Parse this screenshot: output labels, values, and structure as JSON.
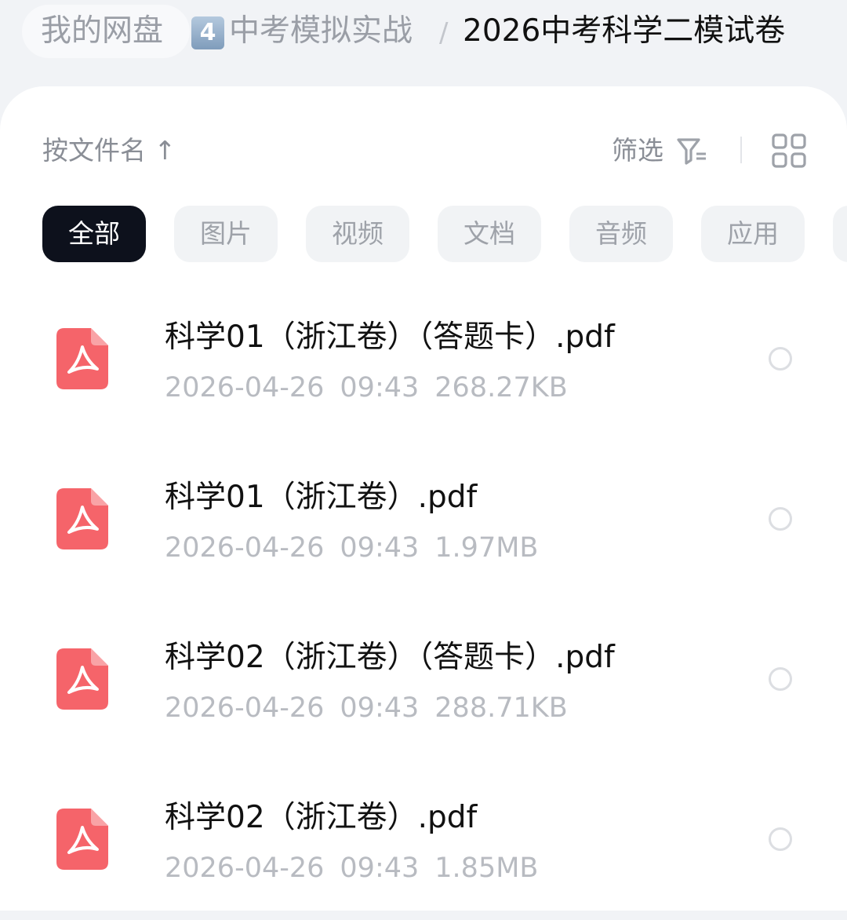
{
  "breadcrumb": {
    "root": "我的网盘",
    "emoji": "4",
    "folder": "中考模拟实战",
    "separator": "/",
    "current": "2026中考科学二模试卷"
  },
  "toolbar": {
    "sort_label": "按文件名 ↑",
    "filter_label": "筛选",
    "filter_icon": "filter-icon",
    "view_icon": "grid-view-icon"
  },
  "tabs": [
    {
      "label": "全部",
      "active": true
    },
    {
      "label": "图片",
      "active": false
    },
    {
      "label": "视频",
      "active": false
    },
    {
      "label": "文档",
      "active": false
    },
    {
      "label": "音频",
      "active": false
    },
    {
      "label": "应用",
      "active": false
    }
  ],
  "files": [
    {
      "name": "科学01（浙江卷）（答题卡）.pdf",
      "date": "2026-04-26",
      "time": "09:43",
      "size": "268.27KB",
      "icon": "pdf-icon",
      "selected": false
    },
    {
      "name": "科学01（浙江卷）.pdf",
      "date": "2026-04-26",
      "time": "09:43",
      "size": "1.97MB",
      "icon": "pdf-icon",
      "selected": false
    },
    {
      "name": "科学02（浙江卷）（答题卡）.pdf",
      "date": "2026-04-26",
      "time": "09:43",
      "size": "288.71KB",
      "icon": "pdf-icon",
      "selected": false
    },
    {
      "name": "科学02（浙江卷）.pdf",
      "date": "2026-04-26",
      "time": "09:43",
      "size": "1.85MB",
      "icon": "pdf-icon",
      "selected": false
    }
  ],
  "colors": {
    "pdf_icon": "#f5646a",
    "active_tab": "#0d111c",
    "muted_text": "#b8bbc1"
  }
}
